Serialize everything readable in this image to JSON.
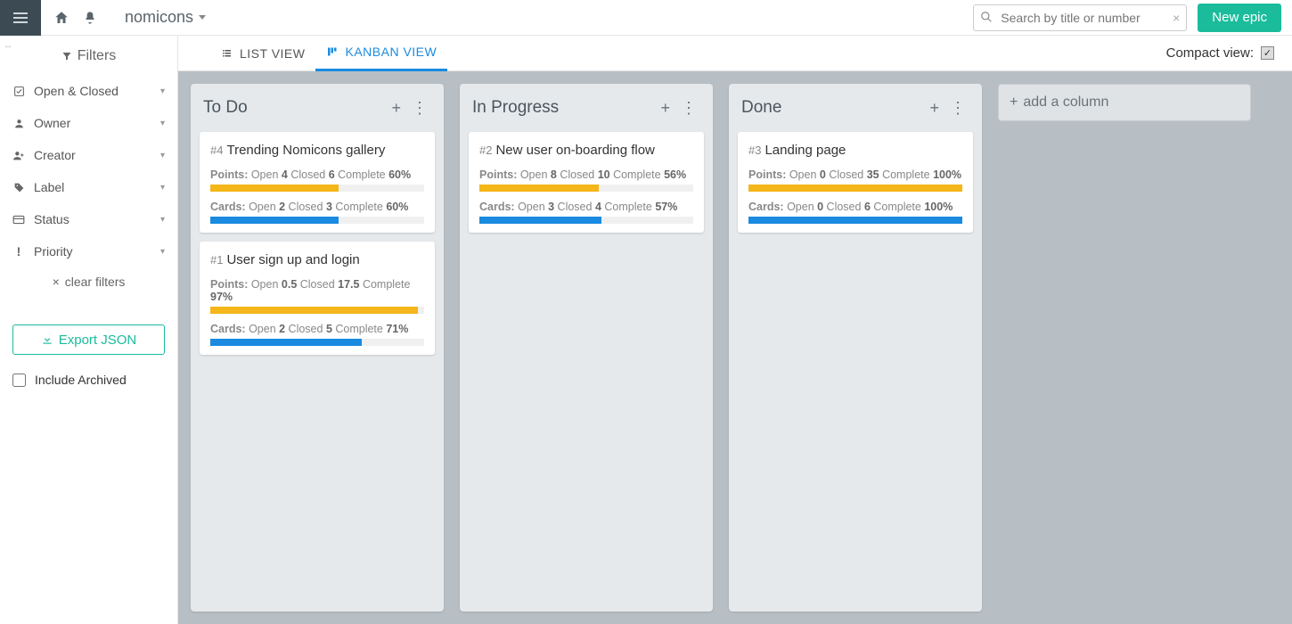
{
  "header": {
    "project_name": "nomicons",
    "search_placeholder": "Search by title or number",
    "new_epic_label": "New epic"
  },
  "sidebar": {
    "filters_title": "Filters",
    "items": [
      {
        "label": "Open & Closed",
        "icon": "check-square-icon"
      },
      {
        "label": "Owner",
        "icon": "user-icon"
      },
      {
        "label": "Creator",
        "icon": "user-plus-icon"
      },
      {
        "label": "Label",
        "icon": "tag-icon"
      },
      {
        "label": "Status",
        "icon": "card-icon"
      },
      {
        "label": "Priority",
        "icon": "exclamation-icon"
      }
    ],
    "clear_filters_label": "clear filters",
    "export_label": "Export JSON",
    "include_archived_label": "Include Archived",
    "include_archived_checked": false
  },
  "view_tabs": {
    "list_label": "LIST VIEW",
    "kanban_label": "KANBAN VIEW",
    "compact_label": "Compact view:",
    "compact_checked": true
  },
  "board": {
    "add_column_label": "add a column",
    "columns": [
      {
        "title": "To Do",
        "cards": [
          {
            "num": "#4",
            "title": "Trending Nomicons gallery",
            "points_open": "4",
            "points_closed": "6",
            "points_complete": "60%",
            "points_pct": 60,
            "cards_open": "2",
            "cards_closed": "3",
            "cards_complete": "60%",
            "cards_pct": 60
          },
          {
            "num": "#1",
            "title": "User sign up and login",
            "points_open": "0.5",
            "points_closed": "17.5",
            "points_complete": "97%",
            "points_pct": 97,
            "cards_open": "2",
            "cards_closed": "5",
            "cards_complete": "71%",
            "cards_pct": 71
          }
        ]
      },
      {
        "title": "In Progress",
        "cards": [
          {
            "num": "#2",
            "title": "New user on-boarding flow",
            "points_open": "8",
            "points_closed": "10",
            "points_complete": "56%",
            "points_pct": 56,
            "cards_open": "3",
            "cards_closed": "4",
            "cards_complete": "57%",
            "cards_pct": 57
          }
        ]
      },
      {
        "title": "Done",
        "cards": [
          {
            "num": "#3",
            "title": "Landing page",
            "points_open": "0",
            "points_closed": "35",
            "points_complete": "100%",
            "points_pct": 100,
            "cards_open": "0",
            "cards_closed": "6",
            "cards_complete": "100%",
            "cards_pct": 100
          }
        ]
      }
    ]
  },
  "labels": {
    "points": "Points:",
    "cards": "Cards:",
    "open": "Open",
    "closed": "Closed",
    "complete": "Complete"
  },
  "colors": {
    "accent_teal": "#1abc9c",
    "accent_blue": "#1a8be0",
    "progress_orange": "#f4b619",
    "board_bg": "#b8bfc4"
  }
}
